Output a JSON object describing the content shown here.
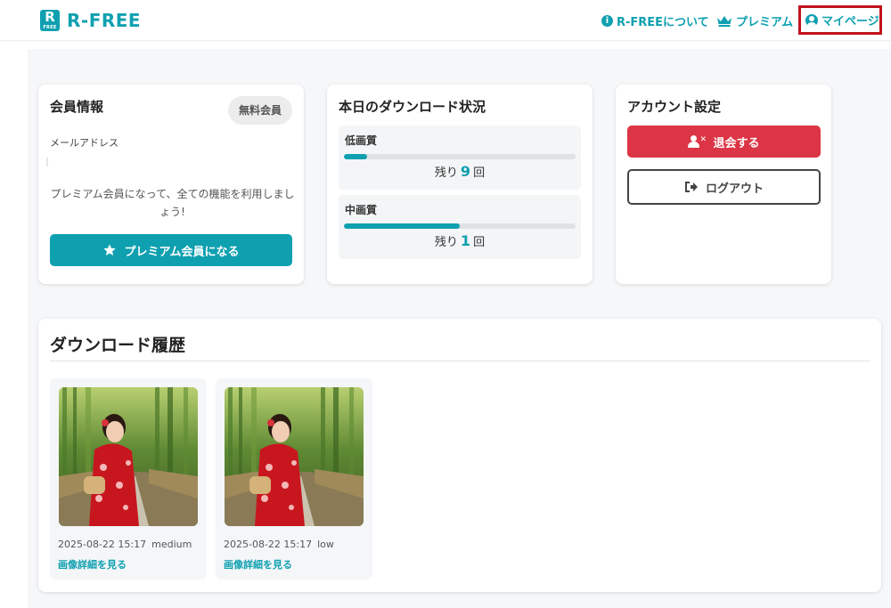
{
  "header": {
    "logo_badge": "R",
    "logo_badge_small": "FREE",
    "logo_text": "R-FREE",
    "nav": {
      "about": "R-FREEについて",
      "premium": "プレミアム",
      "mypage": "マイページ"
    }
  },
  "member": {
    "title": "会員情報",
    "badge": "無料会員",
    "email_label": "メールアドレス",
    "email_value": "",
    "promo": "プレミアム会員になって、全ての機能を利用しましょう!",
    "premium_button": "プレミアム会員になる"
  },
  "download_status": {
    "title": "本日のダウンロード状況",
    "low": {
      "label": "低画質",
      "remaining_prefix": "残り",
      "remaining": "9",
      "remaining_suffix": "回",
      "used_fraction": 0.1
    },
    "medium": {
      "label": "中画質",
      "remaining_prefix": "残り",
      "remaining": "1",
      "remaining_suffix": "回",
      "used_fraction": 0.5
    }
  },
  "account": {
    "title": "アカウント設定",
    "withdraw_button": "退会する",
    "logout_button": "ログアウト"
  },
  "history": {
    "title": "ダウンロード履歴",
    "items": [
      {
        "date": "2025-08-22 15:17",
        "quality": "medium",
        "link": "画像詳細を見る"
      },
      {
        "date": "2025-08-22 15:17",
        "quality": "low",
        "link": "画像詳細を見る"
      }
    ]
  },
  "colors": {
    "accent": "#0fa0b0",
    "danger": "#dc3545",
    "highlight_border": "#c0141e"
  }
}
